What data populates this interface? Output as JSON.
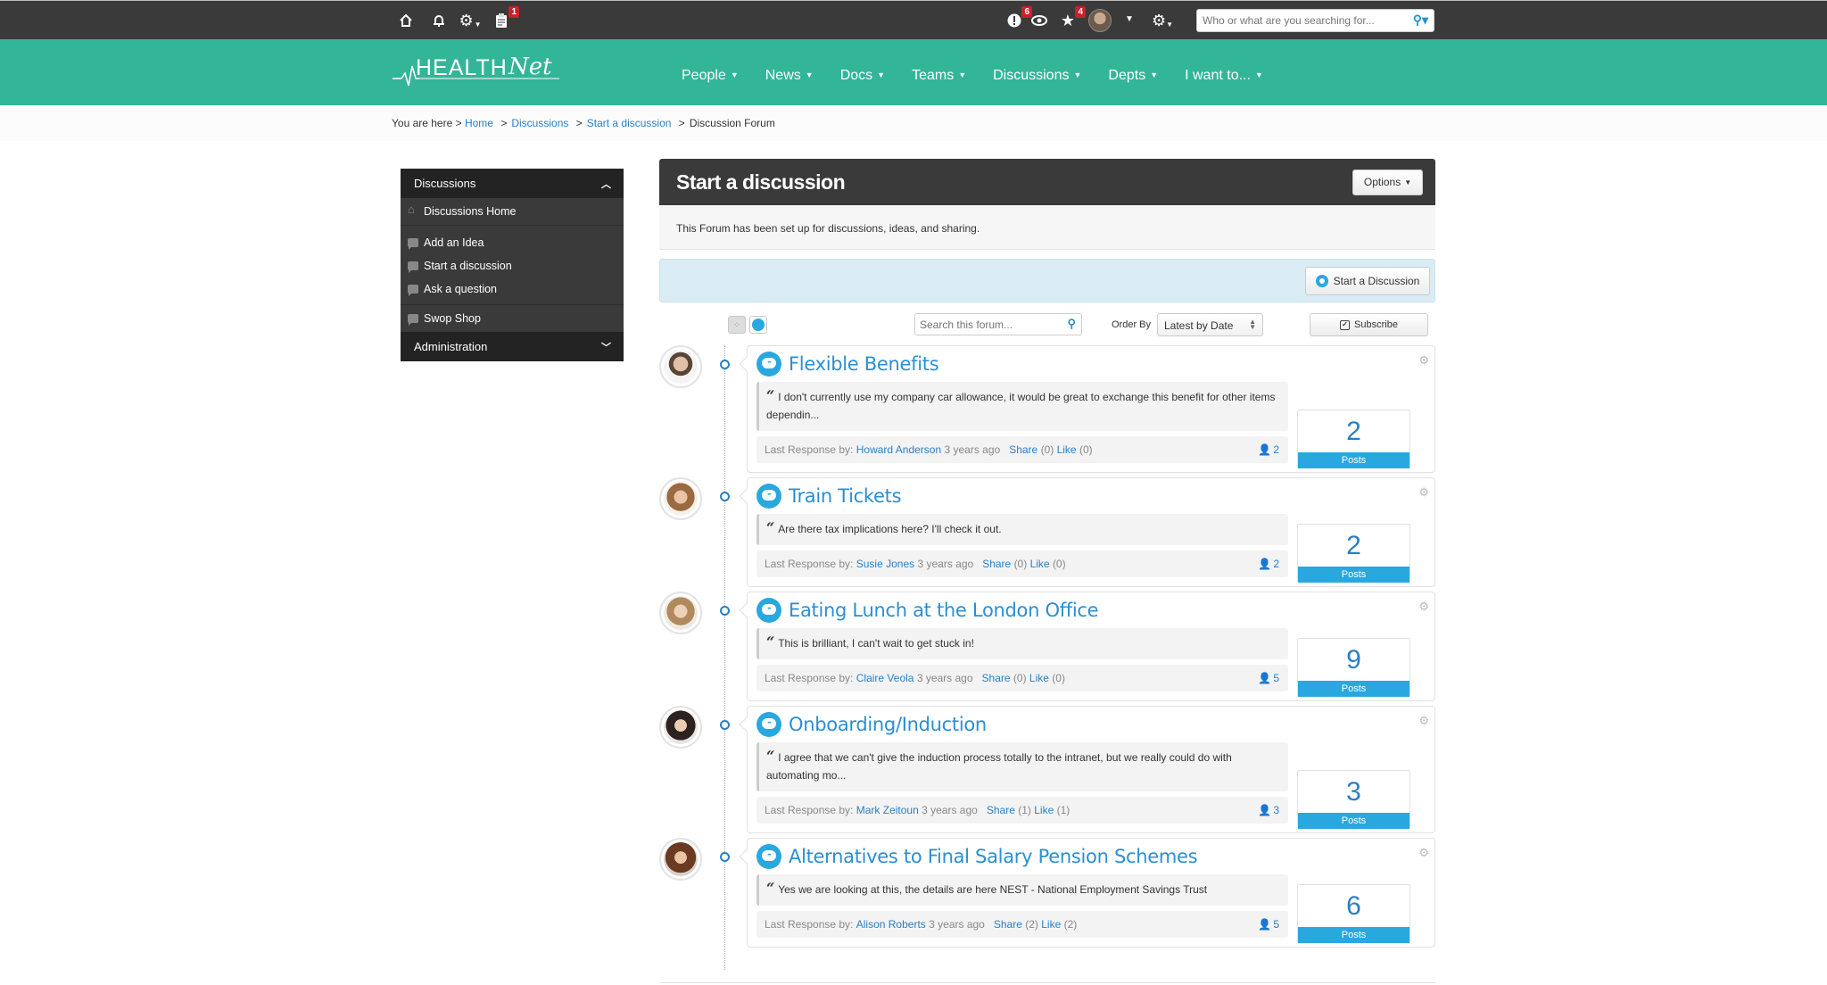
{
  "topbar": {
    "icons": [
      {
        "name": "home-icon"
      },
      {
        "name": "bell-icon"
      },
      {
        "name": "gear-icon"
      },
      {
        "name": "clipboard-icon",
        "badge": "1"
      }
    ],
    "right_icons": [
      {
        "name": "alert-icon",
        "badge": "6"
      },
      {
        "name": "eye-icon"
      },
      {
        "name": "star-icon",
        "badge": "4"
      }
    ],
    "search_placeholder": "Who or what are you searching for..."
  },
  "header": {
    "logo_health": "HEALTH",
    "logo_net": "Net",
    "nav": [
      "People",
      "News",
      "Docs",
      "Teams",
      "Discussions",
      "Depts",
      "I want to..."
    ]
  },
  "breadcrumb": {
    "prefix": "You are here >",
    "links": [
      "Home",
      "Discussions",
      "Start a discussion"
    ],
    "current": "Discussion Forum"
  },
  "sidebar": {
    "section_title": "Discussions",
    "items": [
      {
        "label": "Discussions Home",
        "icon": "home-icon"
      },
      {
        "label": "Add an Idea",
        "icon": "speech-bubble-icon"
      },
      {
        "label": "Start a discussion",
        "icon": "speech-bubble-icon"
      },
      {
        "label": "Ask a question",
        "icon": "speech-bubble-icon"
      },
      {
        "label": "Swop Shop",
        "icon": "speech-bubble-icon"
      }
    ],
    "admin_title": "Administration"
  },
  "panel": {
    "title": "Start a discussion",
    "options_label": "Options",
    "description": "This Forum has been set up for discussions, ideas, and sharing.",
    "start_button": "Start a Discussion"
  },
  "toolbar": {
    "search_placeholder": "Search this forum...",
    "order_by_label": "Order By",
    "order_by_value": "Latest by Date",
    "subscribe_label": "Subscribe"
  },
  "topics": [
    {
      "title": "Flexible Benefits",
      "quote": "I don't currently use my company car allowance, it would be great to exchange this benefit for other items dependin...",
      "last_response_label": "Last Response by:",
      "author": "Howard Anderson",
      "time": "3 years ago",
      "share_label": "Share",
      "share_count": "(0)",
      "like_label": "Like",
      "like_count": "(0)",
      "participants": "2",
      "posts": "2",
      "posts_label": "Posts"
    },
    {
      "title": "Train Tickets",
      "quote": "Are there tax implications here? I'll check it out.",
      "last_response_label": "Last Response by:",
      "author": "Susie Jones",
      "time": "3 years ago",
      "share_label": "Share",
      "share_count": "(0)",
      "like_label": "Like",
      "like_count": "(0)",
      "participants": "2",
      "posts": "2",
      "posts_label": "Posts"
    },
    {
      "title": "Eating Lunch at the London Office",
      "quote": "This is brilliant, I can't wait to get stuck in!",
      "last_response_label": "Last Response by:",
      "author": "Claire Veola",
      "time": "3 years ago",
      "share_label": "Share",
      "share_count": "(0)",
      "like_label": "Like",
      "like_count": "(0)",
      "participants": "5",
      "posts": "9",
      "posts_label": "Posts"
    },
    {
      "title": "Onboarding/Induction",
      "quote": "I agree that we can't give the induction process totally to the intranet, but we really could do with automating mo...",
      "last_response_label": "Last Response by:",
      "author": "Mark Zeitoun",
      "time": "3 years ago",
      "share_label": "Share",
      "share_count": "(1)",
      "like_label": "Like",
      "like_count": "(1)",
      "participants": "3",
      "posts": "3",
      "posts_label": "Posts"
    },
    {
      "title": "Alternatives to Final Salary Pension Schemes",
      "quote": "Yes we are looking at this, the details are here NEST - National Employment Savings Trust",
      "last_response_label": "Last Response by:",
      "author": "Alison Roberts",
      "time": "3 years ago",
      "share_label": "Share",
      "share_count": "(2)",
      "like_label": "Like",
      "like_count": "(2)",
      "participants": "5",
      "posts": "6",
      "posts_label": "Posts"
    }
  ],
  "colors": {
    "header_teal": "#33b598",
    "topbar": "#3a3a3a",
    "link_blue": "#2a7fc4",
    "accent_blue": "#29a8e0",
    "badge_red": "#c9212a"
  }
}
